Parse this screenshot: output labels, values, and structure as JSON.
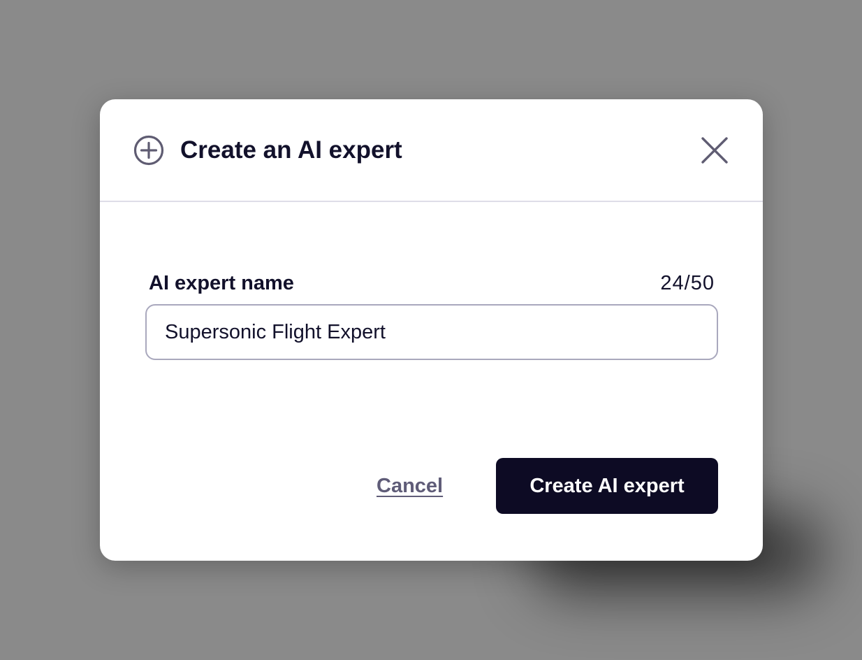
{
  "modal": {
    "title": "Create an AI expert",
    "header_icon": "plus-circle-icon",
    "close_icon": "close-icon"
  },
  "form": {
    "name_label": "AI expert name",
    "name_counter": "24/50",
    "name_value": "Supersonic Flight Expert"
  },
  "actions": {
    "cancel_label": "Cancel",
    "create_label": "Create AI expert"
  },
  "colors": {
    "overlay": "#8a8a8a",
    "primary_button": "#0d0b24",
    "text": "#12112b",
    "muted_link": "#5f5c78",
    "input_border": "#a9a8bd",
    "divider": "#dedde8"
  }
}
